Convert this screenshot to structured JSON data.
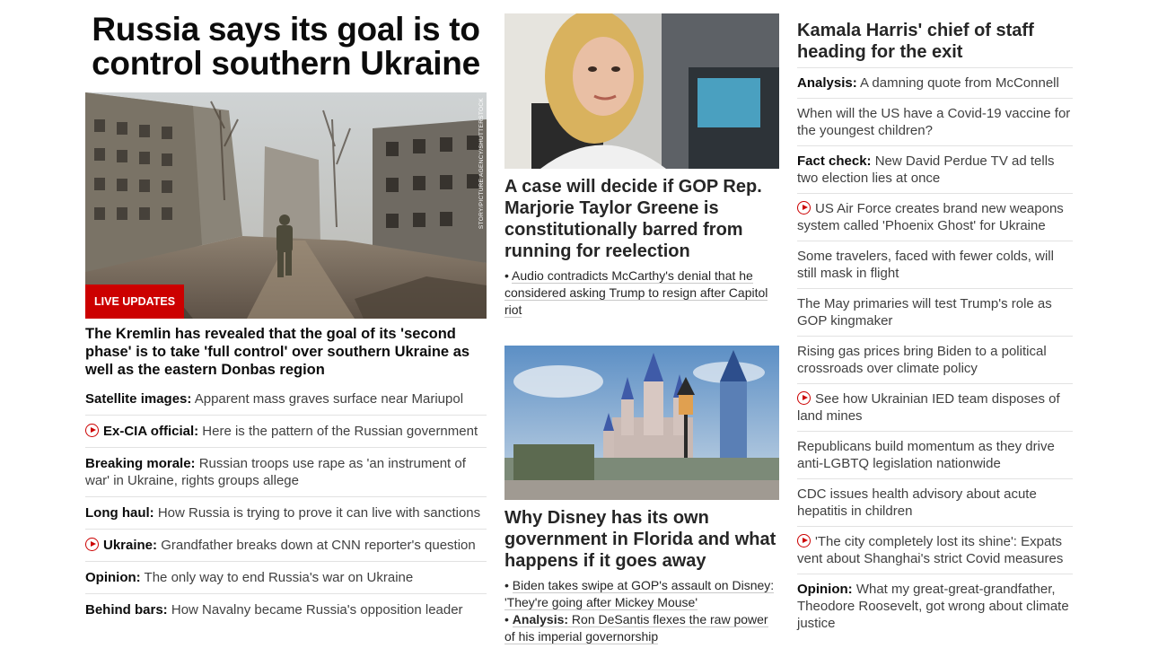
{
  "lead": {
    "title": "Russia says its goal is to control southern Ukraine",
    "badge": "LIVE UPDATES",
    "photo_credit": "STORY/PICTURE AGENCY/SHUTTERSTOCK",
    "subtitle": "The Kremlin has revealed that the goal of its 'second phase' is to take 'full control' over southern Ukraine as well as the eastern Donbas region",
    "headlines": [
      {
        "prefix": "Satellite images:",
        "text": " Apparent mass graves surface near Mariupol",
        "video": false
      },
      {
        "prefix": "Ex-CIA official:",
        "text": " Here is the pattern of the Russian government",
        "video": true
      },
      {
        "prefix": "Breaking morale:",
        "text": " Russian troops use rape as 'an instrument of war' in Ukraine, rights groups allege",
        "video": false
      },
      {
        "prefix": "Long haul:",
        "text": " How Russia is trying to prove it can live with sanctions",
        "video": false
      },
      {
        "prefix": "Ukraine:",
        "text": " Grandfather breaks down at CNN reporter's question",
        "video": true
      },
      {
        "prefix": "Opinion:",
        "text": " The only way to end Russia's war on Ukraine",
        "video": false
      },
      {
        "prefix": "Behind bars:",
        "text": " How Navalny became Russia's opposition leader",
        "video": false
      }
    ]
  },
  "middle": {
    "story1": {
      "title": "A case will decide if GOP Rep. Marjorie Taylor Greene is constitutionally barred from running for reelection",
      "bullet": "Audio contradicts McCarthy's denial that he considered asking Trump to resign after Capitol riot"
    },
    "story2": {
      "title": "Why Disney has its own government in Florida and what happens if it goes away",
      "bullet1": "Biden takes swipe at GOP's assault on Disney: 'They're going after Mickey Mouse'",
      "bullet2_prefix": "Analysis:",
      "bullet2_text": " Ron DeSantis flexes the raw power of his imperial governorship"
    },
    "bullet_char": "•"
  },
  "right": {
    "title": "Kamala Harris' chief of staff heading for the exit",
    "headlines": [
      {
        "prefix": "Analysis:",
        "text": " A damning quote from McConnell",
        "video": false
      },
      {
        "prefix": "",
        "text": "When will the US have a Covid-19 vaccine for the youngest children?",
        "video": false
      },
      {
        "prefix": "Fact check:",
        "text": " New David Perdue TV ad tells two election lies at once",
        "video": false
      },
      {
        "prefix": "",
        "text": "US Air Force creates brand new weapons system called 'Phoenix Ghost' for Ukraine",
        "video": true
      },
      {
        "prefix": "",
        "text": "Some travelers, faced with fewer colds, will still mask in flight",
        "video": false
      },
      {
        "prefix": "",
        "text": "The May primaries will test Trump's role as GOP kingmaker",
        "video": false
      },
      {
        "prefix": "",
        "text": "Rising gas prices bring Biden to a political crossroads over climate policy",
        "video": false
      },
      {
        "prefix": "",
        "text": "See how Ukrainian IED team disposes of land mines",
        "video": true
      },
      {
        "prefix": "",
        "text": "Republicans build momentum as they drive anti-LGBTQ legislation nationwide",
        "video": false
      },
      {
        "prefix": "",
        "text": "CDC issues health advisory about acute hepatitis in children",
        "video": false
      },
      {
        "prefix": "",
        "text": "'The city completely lost its shine': Expats vent about Shanghai's strict Covid measures",
        "video": true
      },
      {
        "prefix": "Opinion:",
        "text": " What my great-great-grandfather, Theodore Roosevelt, got wrong about climate justice",
        "video": false
      }
    ]
  },
  "colors": {
    "accent": "#cc0000",
    "text": "#0c0c0c",
    "divider": "#e2e2e2"
  }
}
